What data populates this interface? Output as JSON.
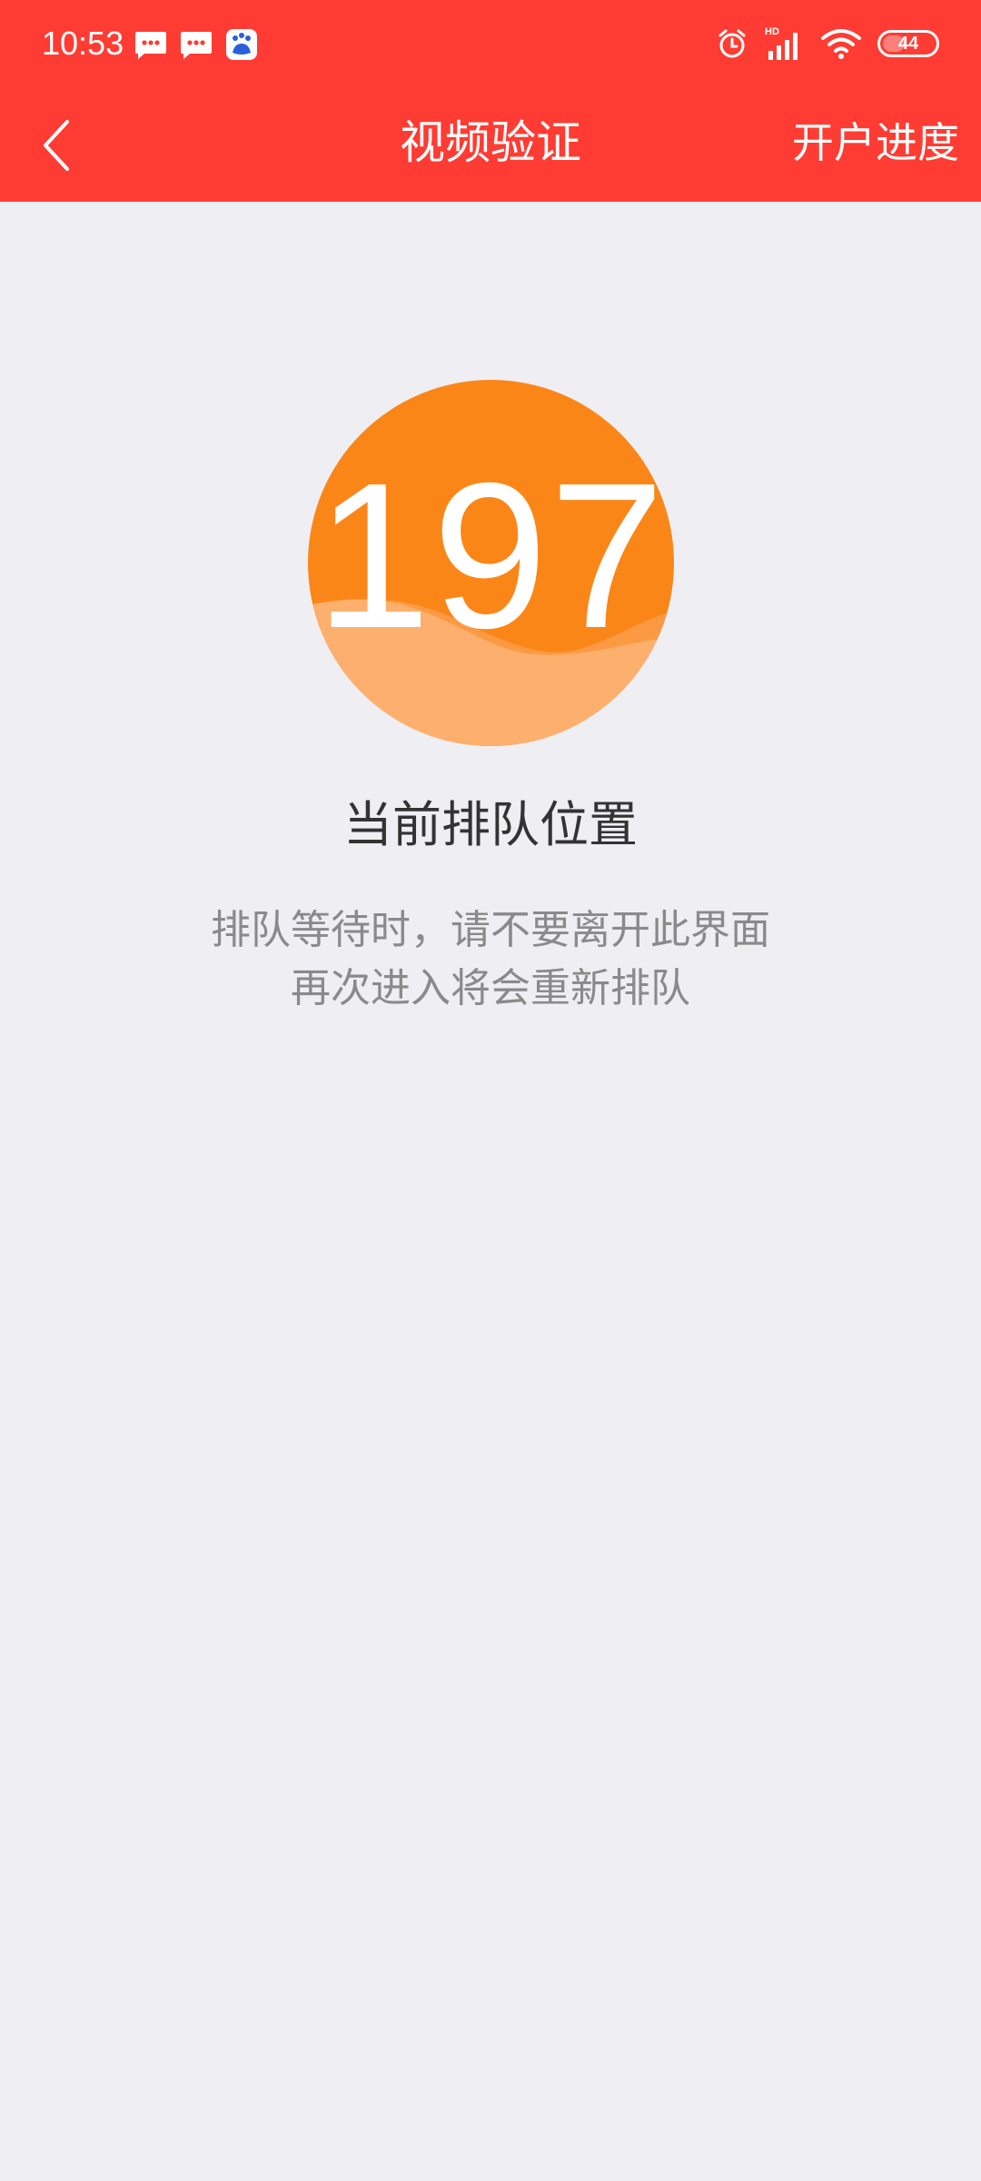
{
  "status_bar": {
    "time": "10:53",
    "icons": [
      "message-icon",
      "message-icon",
      "baidu-icon"
    ],
    "right_icons": [
      "alarm-icon",
      "hd-signal-icon",
      "wifi-icon"
    ],
    "battery": "44"
  },
  "nav": {
    "back_icon": "chevron-left-icon",
    "title": "视频验证",
    "action": "开户进度"
  },
  "queue": {
    "position": "197",
    "label": "当前排队位置",
    "hint_line1": "排队等待时，请不要离开此界面",
    "hint_line2": "再次进入将会重新排队"
  },
  "colors": {
    "header": "#fe3c33",
    "background": "#efeef3",
    "circle": "#fb8618",
    "wave_light": "#fdb06d"
  }
}
